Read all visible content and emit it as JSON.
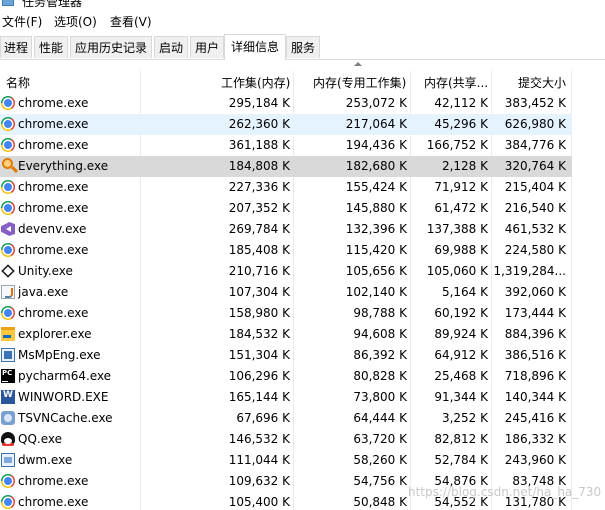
{
  "window": {
    "title": "任务管理器"
  },
  "menu": [
    {
      "label": "文件(F)"
    },
    {
      "label": "选项(O)"
    },
    {
      "label": "查看(V)"
    }
  ],
  "tabs": [
    {
      "label": "进程",
      "active": false
    },
    {
      "label": "性能",
      "active": false
    },
    {
      "label": "应用历史记录",
      "active": false
    },
    {
      "label": "启动",
      "active": false
    },
    {
      "label": "用户",
      "active": false
    },
    {
      "label": "详细信息",
      "active": true
    },
    {
      "label": "服务",
      "active": false
    }
  ],
  "columns": [
    {
      "label": "名称"
    },
    {
      "label": "工作集(内存)"
    },
    {
      "label": "内存(专用工作集)"
    },
    {
      "label": "内存(共享..."
    },
    {
      "label": "提交大小"
    }
  ],
  "sort": {
    "column": "内存(专用工作集)",
    "direction": "descending"
  },
  "rows": [
    {
      "name": "chrome.exe",
      "icon": "chrome-icon",
      "working_set": "295,184 K",
      "private_ws": "253,072 K",
      "shared_ws": "42,112 K",
      "commit": "383,452 K",
      "state": ""
    },
    {
      "name": "chrome.exe",
      "icon": "chrome-icon",
      "working_set": "262,360 K",
      "private_ws": "217,064 K",
      "shared_ws": "45,296 K",
      "commit": "626,980 K",
      "state": "hover"
    },
    {
      "name": "chrome.exe",
      "icon": "chrome-icon",
      "working_set": "361,188 K",
      "private_ws": "194,436 K",
      "shared_ws": "166,752 K",
      "commit": "384,776 K",
      "state": ""
    },
    {
      "name": "Everything.exe",
      "icon": "everything-icon",
      "working_set": "184,808 K",
      "private_ws": "182,680 K",
      "shared_ws": "2,128 K",
      "commit": "320,764 K",
      "state": "selected"
    },
    {
      "name": "chrome.exe",
      "icon": "chrome-icon",
      "working_set": "227,336 K",
      "private_ws": "155,424 K",
      "shared_ws": "71,912 K",
      "commit": "215,404 K",
      "state": ""
    },
    {
      "name": "chrome.exe",
      "icon": "chrome-icon",
      "working_set": "207,352 K",
      "private_ws": "145,880 K",
      "shared_ws": "61,472 K",
      "commit": "216,540 K",
      "state": ""
    },
    {
      "name": "devenv.exe",
      "icon": "visual-studio-icon",
      "working_set": "269,784 K",
      "private_ws": "132,396 K",
      "shared_ws": "137,388 K",
      "commit": "461,532 K",
      "state": ""
    },
    {
      "name": "chrome.exe",
      "icon": "chrome-icon",
      "working_set": "185,408 K",
      "private_ws": "115,420 K",
      "shared_ws": "69,988 K",
      "commit": "224,580 K",
      "state": ""
    },
    {
      "name": "Unity.exe",
      "icon": "unity-icon",
      "working_set": "210,716 K",
      "private_ws": "105,656 K",
      "shared_ws": "105,060 K",
      "commit": "1,319,284...",
      "state": ""
    },
    {
      "name": "java.exe",
      "icon": "java-icon",
      "working_set": "107,304 K",
      "private_ws": "102,140 K",
      "shared_ws": "5,164 K",
      "commit": "392,060 K",
      "state": ""
    },
    {
      "name": "chrome.exe",
      "icon": "chrome-icon",
      "working_set": "158,980 K",
      "private_ws": "98,788 K",
      "shared_ws": "60,192 K",
      "commit": "173,444 K",
      "state": ""
    },
    {
      "name": "explorer.exe",
      "icon": "folder-icon",
      "working_set": "184,532 K",
      "private_ws": "94,608 K",
      "shared_ws": "89,924 K",
      "commit": "884,396 K",
      "state": ""
    },
    {
      "name": "MsMpEng.exe",
      "icon": "defender-icon",
      "working_set": "151,304 K",
      "private_ws": "86,392 K",
      "shared_ws": "64,912 K",
      "commit": "386,516 K",
      "state": ""
    },
    {
      "name": "pycharm64.exe",
      "icon": "pycharm-icon",
      "working_set": "106,296 K",
      "private_ws": "80,828 K",
      "shared_ws": "25,468 K",
      "commit": "718,896 K",
      "state": ""
    },
    {
      "name": "WINWORD.EXE",
      "icon": "word-icon",
      "working_set": "165,144 K",
      "private_ws": "73,800 K",
      "shared_ws": "91,344 K",
      "commit": "140,344 K",
      "state": ""
    },
    {
      "name": "TSVNCache.exe",
      "icon": "tortoisesvn-icon",
      "working_set": "67,696 K",
      "private_ws": "64,444 K",
      "shared_ws": "3,252 K",
      "commit": "245,416 K",
      "state": ""
    },
    {
      "name": "QQ.exe",
      "icon": "qq-icon",
      "working_set": "146,532 K",
      "private_ws": "63,720 K",
      "shared_ws": "82,812 K",
      "commit": "186,332 K",
      "state": ""
    },
    {
      "name": "dwm.exe",
      "icon": "dwm-icon",
      "working_set": "111,044 K",
      "private_ws": "58,260 K",
      "shared_ws": "52,784 K",
      "commit": "243,960 K",
      "state": ""
    },
    {
      "name": "chrome.exe",
      "icon": "chrome-icon",
      "working_set": "109,632 K",
      "private_ws": "54,756 K",
      "shared_ws": "54,876 K",
      "commit": "83,748 K",
      "state": ""
    },
    {
      "name": "chrome.exe",
      "icon": "chrome-icon",
      "working_set": "105,400 K",
      "private_ws": "50,848 K",
      "shared_ws": "54,552 K",
      "commit": "131,780 K",
      "state": ""
    }
  ],
  "watermark": "https://blog.csdn.net/ha_ha_730",
  "colors": {
    "hover_row": "#e5f3ff",
    "selected_row": "#d9d9d9",
    "chrome_blue": "#4285f4",
    "word_blue": "#2b579a"
  }
}
